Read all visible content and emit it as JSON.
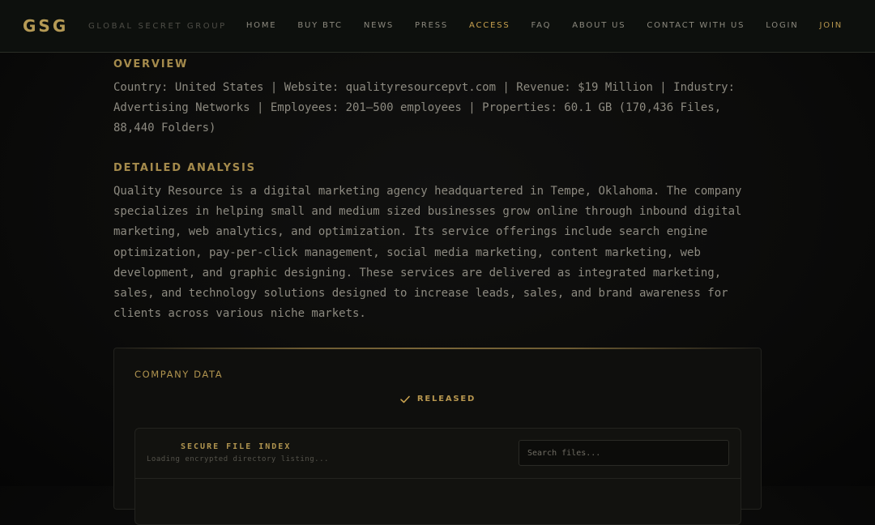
{
  "header": {
    "logo": "GSG",
    "tagline": "GLOBAL SECRET GROUP",
    "nav": [
      {
        "label": "HOME"
      },
      {
        "label": "BUY BTC"
      },
      {
        "label": "NEWS"
      },
      {
        "label": "PRESS"
      },
      {
        "label": "ACCESS"
      },
      {
        "label": "FAQ"
      },
      {
        "label": "ABOUT US"
      },
      {
        "label": "CONTACT WITH US"
      },
      {
        "label": "LOGIN"
      },
      {
        "label": "JOIN"
      }
    ],
    "active": "ACCESS"
  },
  "overview": {
    "heading": "OVERVIEW",
    "text": "Country: United States | Website: qualityresourcepvt.com | Revenue: $19 Million | Industry: Advertising Networks | Employees: 201–500 employees | Properties: 60.1 GB (170,436 Files, 88,440 Folders)"
  },
  "analysis": {
    "heading": "DETAILED ANALYSIS",
    "text": "Quality Resource is a digital marketing agency headquartered in Tempe, Oklahoma. The company specializes in helping small and medium sized businesses grow online through inbound digital marketing, web analytics, and optimization. Its service offerings include search engine optimization, pay-per-click management, social media marketing, content marketing, web development, and graphic designing. These services are delivered as integrated marketing, sales, and technology solutions designed to increase leads, sales, and brand awareness for clients across various niche markets."
  },
  "company_data": {
    "title": "COMPANY DATA",
    "status": "RELEASED",
    "status_icon": "check-icon",
    "file_index": {
      "title": "SECURE FILE INDEX",
      "subtitle": "Loading encrypted directory listing...",
      "search_placeholder": "Search files..."
    }
  },
  "colors": {
    "accent": "#b59a55",
    "active_nav": "#c9a24f",
    "background": "#0b0b0a"
  }
}
